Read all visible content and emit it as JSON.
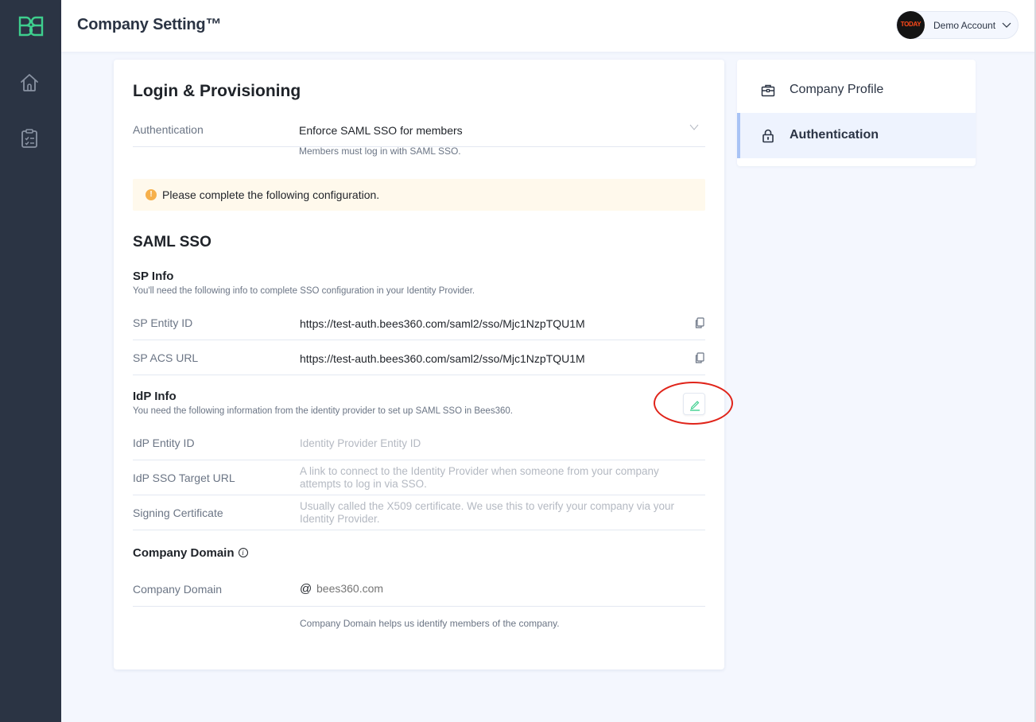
{
  "app": {
    "logo": "BB",
    "nav": [
      {
        "name": "home",
        "icon": "home-icon"
      },
      {
        "name": "tasks",
        "icon": "clipboard-checklist-icon"
      }
    ]
  },
  "header": {
    "title": "Company Setting™",
    "account": {
      "avatar_text": "TODAY",
      "name": "Demo Account"
    }
  },
  "login_provisioning": {
    "title": "Login & Provisioning",
    "authentication_label": "Authentication",
    "authentication_value": "Enforce SAML SSO for members",
    "authentication_hint": "Members must log in with SAML SSO.",
    "alert": "Please complete the following configuration."
  },
  "saml": {
    "title": "SAML SSO",
    "sp_info": {
      "title": "SP Info",
      "description": "You'll need the following info to complete SSO configuration in your Identity Provider.",
      "rows": [
        {
          "label": "SP Entity ID",
          "value": "https://test-auth.bees360.com/saml2/sso/Mjc1NzpTQU1M"
        },
        {
          "label": "SP ACS URL",
          "value": "https://test-auth.bees360.com/saml2/sso/Mjc1NzpTQU1M"
        }
      ]
    },
    "idp_info": {
      "title": "IdP Info",
      "description": "You need the following information from the identity provider to set up SAML SSO in Bees360.",
      "rows": [
        {
          "label": "IdP Entity ID",
          "placeholder": "Identity Provider Entity ID"
        },
        {
          "label": "IdP SSO Target URL",
          "placeholder": "A link to connect to the Identity Provider when someone from your company attempts to log in via SSO."
        },
        {
          "label": "Signing Certificate",
          "placeholder": "Usually called the X509 certificate. We use this to verify your company via your Identity Provider."
        }
      ]
    }
  },
  "company_domain": {
    "title": "Company Domain",
    "label": "Company Domain",
    "prefix": "@",
    "placeholder": "bees360.com",
    "hint": "Company Domain helps us identify members of the company."
  },
  "side_menu": {
    "items": [
      {
        "label": "Company Profile",
        "icon": "briefcase-icon",
        "active": false
      },
      {
        "label": "Authentication",
        "icon": "lock-icon",
        "active": true
      }
    ]
  },
  "colors": {
    "sidebar_bg": "#2b3444",
    "brand_green": "#3ecf8e",
    "page_bg": "#f4f7fe",
    "alert_bg": "#fff9ec",
    "alert_icon": "#f6b04b",
    "active_menu_bg": "#eef3fe",
    "highlight_ring": "#e0241a"
  }
}
